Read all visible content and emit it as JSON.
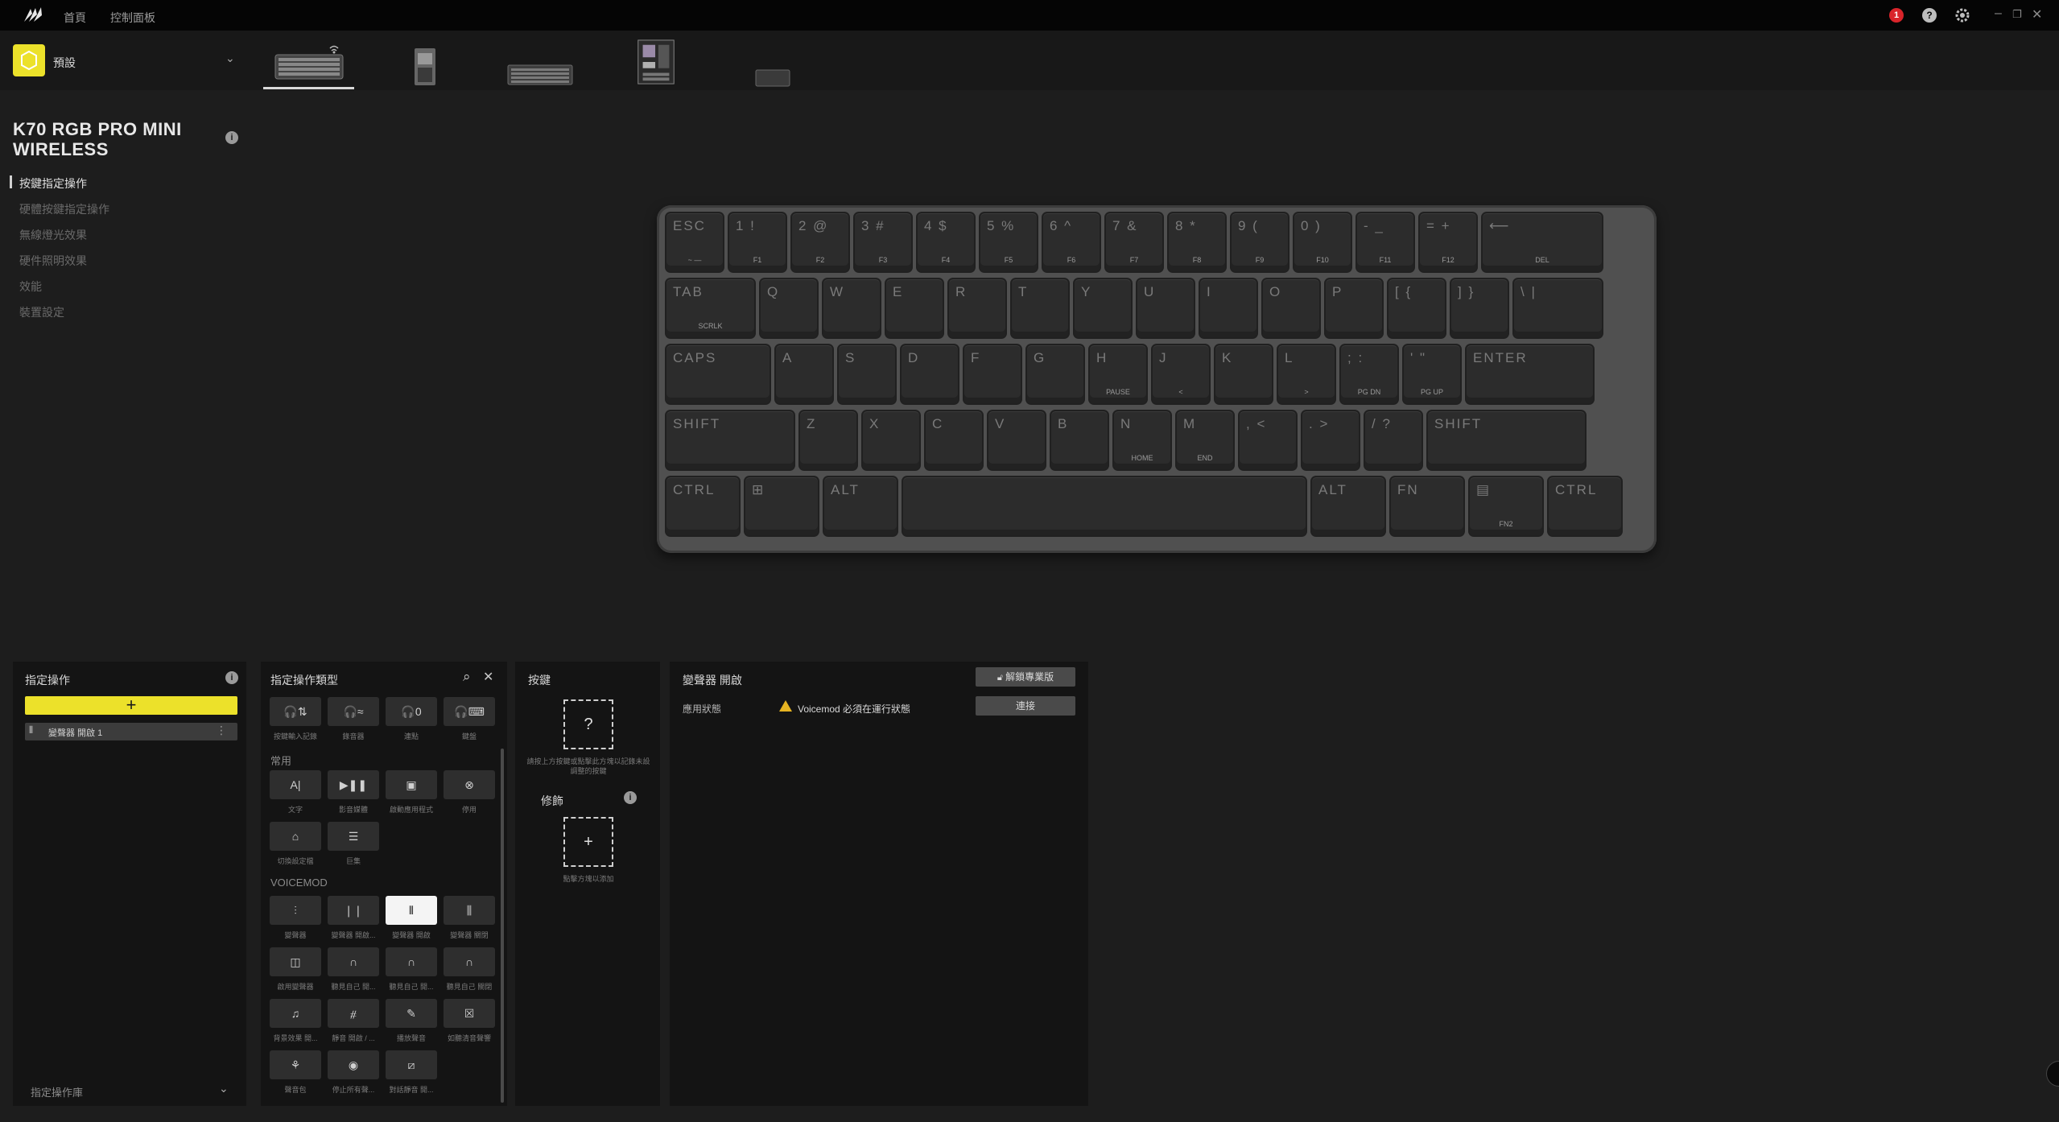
{
  "topbar": {
    "nav": [
      "首頁",
      "控制面板"
    ],
    "notification_count": "1"
  },
  "profile": {
    "name": "預設"
  },
  "device": {
    "title": "K70 RGB PRO MINI WIRELESS"
  },
  "sidebar": {
    "items": [
      {
        "label": "按鍵指定操作"
      },
      {
        "label": "硬體按鍵指定操作"
      },
      {
        "label": "無線燈光效果"
      },
      {
        "label": "硬件照明效果"
      },
      {
        "label": "效能"
      },
      {
        "label": "裝置設定"
      }
    ]
  },
  "keyboard": {
    "rows": [
      [
        {
          "legend": "ESC",
          "sub": "~ —"
        },
        {
          "legend": "1 !",
          "sub": "F1"
        },
        {
          "legend": "2 @",
          "sub": "F2"
        },
        {
          "legend": "3 #",
          "sub": "F3"
        },
        {
          "legend": "4 $",
          "sub": "F4"
        },
        {
          "legend": "5 %",
          "sub": "F5"
        },
        {
          "legend": "6 ^",
          "sub": "F6"
        },
        {
          "legend": "7 &",
          "sub": "F7"
        },
        {
          "legend": "8 *",
          "sub": "F8"
        },
        {
          "legend": "9 (",
          "sub": "F9"
        },
        {
          "legend": "0 )",
          "sub": "F10"
        },
        {
          "legend": "- _",
          "sub": "F11"
        },
        {
          "legend": "= +",
          "sub": "F12"
        },
        {
          "legend": "⟵",
          "sub": "DEL"
        }
      ],
      [
        {
          "legend": "TAB",
          "sub": "SCRLK"
        },
        {
          "legend": "Q",
          "sub": ""
        },
        {
          "legend": "W",
          "sub": ""
        },
        {
          "legend": "E",
          "sub": ""
        },
        {
          "legend": "R",
          "sub": ""
        },
        {
          "legend": "T",
          "sub": ""
        },
        {
          "legend": "Y",
          "sub": ""
        },
        {
          "legend": "U",
          "sub": ""
        },
        {
          "legend": "I",
          "sub": ""
        },
        {
          "legend": "O",
          "sub": ""
        },
        {
          "legend": "P",
          "sub": ""
        },
        {
          "legend": "[ {",
          "sub": ""
        },
        {
          "legend": "] }",
          "sub": ""
        },
        {
          "legend": "\\ |",
          "sub": ""
        }
      ],
      [
        {
          "legend": "CAPS",
          "sub": ""
        },
        {
          "legend": "A",
          "sub": ""
        },
        {
          "legend": "S",
          "sub": ""
        },
        {
          "legend": "D",
          "sub": ""
        },
        {
          "legend": "F",
          "sub": ""
        },
        {
          "legend": "G",
          "sub": ""
        },
        {
          "legend": "H",
          "sub": "PAUSE"
        },
        {
          "legend": "J",
          "sub": "<"
        },
        {
          "legend": "K",
          "sub": ""
        },
        {
          "legend": "L",
          "sub": ">"
        },
        {
          "legend": "; :",
          "sub": "PG DN"
        },
        {
          "legend": "' \"",
          "sub": "PG UP"
        },
        {
          "legend": "ENTER",
          "sub": ""
        }
      ],
      [
        {
          "legend": "SHIFT",
          "sub": ""
        },
        {
          "legend": "Z",
          "sub": ""
        },
        {
          "legend": "X",
          "sub": ""
        },
        {
          "legend": "C",
          "sub": ""
        },
        {
          "legend": "V",
          "sub": ""
        },
        {
          "legend": "B",
          "sub": ""
        },
        {
          "legend": "N",
          "sub": "HOME"
        },
        {
          "legend": "M",
          "sub": "END"
        },
        {
          "legend": ", <",
          "sub": ""
        },
        {
          "legend": ". >",
          "sub": ""
        },
        {
          "legend": "/ ?",
          "sub": ""
        },
        {
          "legend": "SHIFT",
          "sub": ""
        }
      ],
      [
        {
          "legend": "CTRL",
          "sub": ""
        },
        {
          "legend": "⊞",
          "sub": ""
        },
        {
          "legend": "ALT",
          "sub": ""
        },
        {
          "legend": "",
          "sub": ""
        },
        {
          "legend": "ALT",
          "sub": ""
        },
        {
          "legend": "FN",
          "sub": ""
        },
        {
          "legend": "▤",
          "sub": "FN2"
        },
        {
          "legend": "CTRL",
          "sub": ""
        }
      ]
    ]
  },
  "assign_panel": {
    "title": "指定操作",
    "add_label": "+",
    "item_label": "變聲器 開啟 1",
    "library_label": "指定操作庫"
  },
  "type_panel": {
    "title": "指定操作類型",
    "top_tiles": [
      {
        "label": "按鍵輸入記錄",
        "icon": "🎧⇅"
      },
      {
        "label": "錄音器",
        "icon": "🎧≈"
      },
      {
        "label": "連點",
        "icon": "🎧0"
      },
      {
        "label": "鍵盤",
        "icon": "🎧⌨"
      }
    ],
    "common_label": "常用",
    "common_tiles": [
      {
        "label": "文字",
        "icon": "A|"
      },
      {
        "label": "影音媒體",
        "icon": "▶❚❚"
      },
      {
        "label": "啟動應用程式",
        "icon": "▣"
      },
      {
        "label": "停用",
        "icon": "⊗"
      },
      {
        "label": "切換設定檔",
        "icon": "⌂"
      },
      {
        "label": "巨集",
        "icon": "☰"
      }
    ],
    "voicemod_label": "VOICEMOD",
    "voicemod_tiles": [
      {
        "label": "變聲器",
        "icon": "⫶"
      },
      {
        "label": "變聲器 開啟...",
        "icon": "❘❘"
      },
      {
        "label": "變聲器 開啟",
        "icon": "⫴"
      },
      {
        "label": "變聲器 關閉",
        "icon": "⫼"
      },
      {
        "label": "啟用變聲器",
        "icon": "◫"
      },
      {
        "label": "聽見自己 開...",
        "icon": "∩"
      },
      {
        "label": "聽見自己 開...",
        "icon": "∩"
      },
      {
        "label": "聽見自己 關閉",
        "icon": "∩"
      },
      {
        "label": "背景效果 開...",
        "icon": "♫"
      },
      {
        "label": "靜音 開啟 / ...",
        "icon": "⧣"
      },
      {
        "label": "播放聲音",
        "icon": "✎"
      },
      {
        "label": "如聽清音聲響",
        "icon": "☒"
      },
      {
        "label": "聲音包",
        "icon": "⚘"
      },
      {
        "label": "停止所有聲...",
        "icon": "◉"
      },
      {
        "label": "對話靜音 開...",
        "icon": "⧄"
      }
    ]
  },
  "key_panel": {
    "title": "按鍵",
    "key_placeholder": "?",
    "key_hint": "請按上方按鍵或點擊此方塊以記錄未設調整的按鍵",
    "modifier_title": "修飾",
    "modifier_placeholder": "+",
    "modifier_hint": "點擊方塊以添加"
  },
  "detail_panel": {
    "title": "變聲器 開啟",
    "unlock_button": "解鎖專業版",
    "status_label": "應用狀態",
    "warning_text": "Voicemod 必須在運行狀態",
    "connect_button": "連接"
  }
}
